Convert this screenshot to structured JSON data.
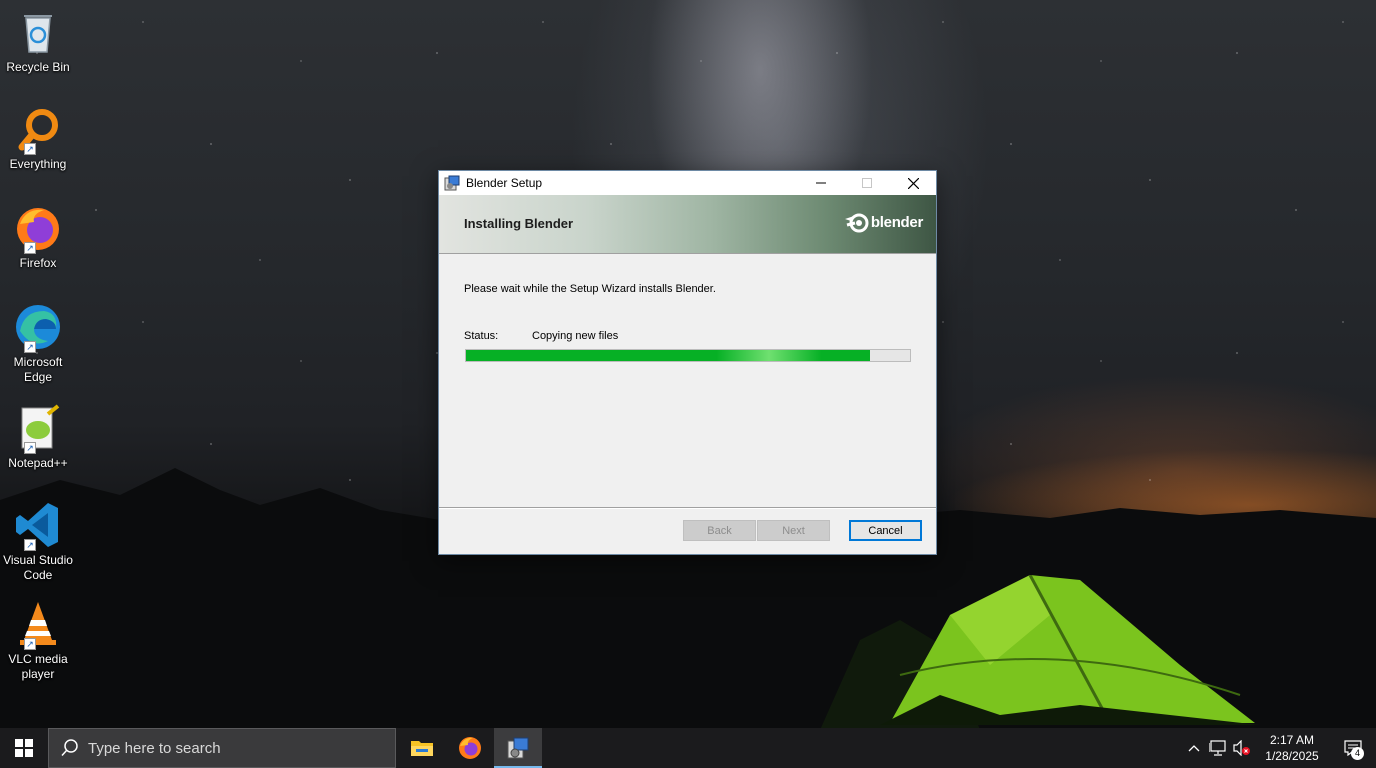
{
  "desktop": {
    "icons": [
      {
        "label": "Recycle Bin",
        "icon": "recycle-bin-icon"
      },
      {
        "label": "Everything",
        "icon": "everything-search-icon"
      },
      {
        "label": "Firefox",
        "icon": "firefox-icon"
      },
      {
        "label": "Microsoft Edge",
        "icon": "edge-icon"
      },
      {
        "label": "Notepad++",
        "icon": "notepad-plus-plus-icon"
      },
      {
        "label": "Visual Studio Code",
        "icon": "vscode-icon"
      },
      {
        "label": "VLC media player",
        "icon": "vlc-icon"
      }
    ]
  },
  "dialog": {
    "title": "Blender Setup",
    "banner_heading": "Installing Blender",
    "logo_text": "blender",
    "message": "Please wait while the Setup Wizard installs Blender.",
    "status_label": "Status:",
    "status_value": "Copying new files",
    "progress_fraction": 0.91,
    "back_label": "Back",
    "next_label": "Next",
    "cancel_label": "Cancel"
  },
  "taskbar": {
    "search_placeholder": "Type here to search",
    "apps": [
      "file-explorer-icon",
      "firefox-icon",
      "blender-setup-icon"
    ],
    "time": "2:17 AM",
    "date": "1/28/2025",
    "notification_count": "4"
  },
  "colors": {
    "progress": "#06b025",
    "accent": "#0078d7",
    "taskbar": "#1b1b1d"
  }
}
